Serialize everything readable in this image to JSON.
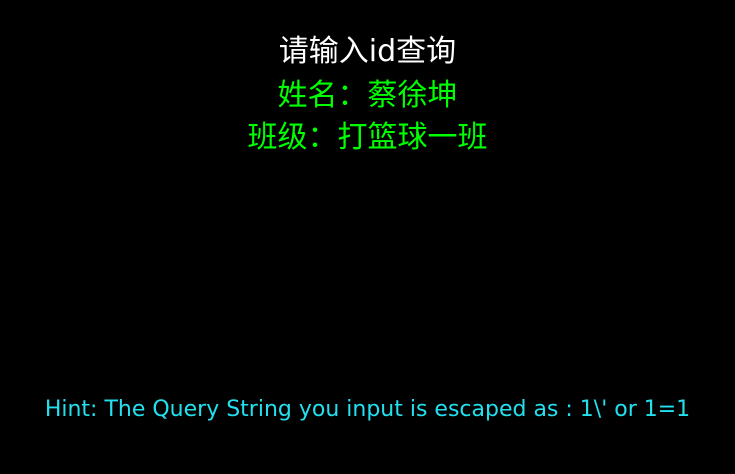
{
  "page": {
    "prompt": "请输入id查询",
    "result": {
      "name_line": "姓名：蔡徐坤",
      "class_line": "班级：打篮球一班"
    },
    "hint": "Hint: The Query String you input is escaped as : 1\\' or 1=1"
  },
  "colors": {
    "background": "#000000",
    "prompt": "#ffffff",
    "result": "#00ff00",
    "hint": "#22e0ee"
  }
}
